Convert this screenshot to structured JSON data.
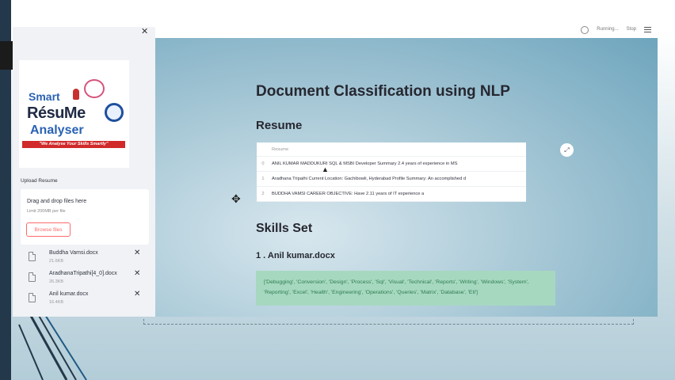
{
  "topbar": {
    "status_text": "Running...",
    "stop_label": "Stop"
  },
  "sidebar": {
    "logo": {
      "line1": "Smart",
      "line2": "RésuMe",
      "line3": "Analyser",
      "tagline": "\"We Analyse Your Skills Smartly\""
    },
    "upload_label": "Upload Resume",
    "dropzone": {
      "title": "Drag and drop files here",
      "limit": "Limit 200MB per file",
      "browse_label": "Browse files"
    },
    "files": [
      {
        "name": "Buddha Vamsi.docx",
        "size": "21.6KB"
      },
      {
        "name": "AradhanaTripathi[4_0].docx",
        "size": "26.3KB"
      },
      {
        "name": "Anil kumar.docx",
        "size": "16.4KB"
      }
    ]
  },
  "main": {
    "title": "Document Classification using NLP",
    "resume_heading": "Resume",
    "table": {
      "header": "Resume",
      "rows": [
        {
          "index": "0",
          "text": "ANIL KUMAR MADDUKURI        SQL & MSBI Developer              Summary    2.4 years of experience in MS"
        },
        {
          "index": "1",
          "text": "Aradhana Tripathi    Current Location: Gachibowli, Hyderabad    Profile Summary:    An accomplished d"
        },
        {
          "index": "2",
          "text": "BUDDHA VAMSI                                               CAREER OBJECTIVE:    Have 2.11 years of IT experience a"
        }
      ]
    },
    "skills_heading": "Skills Set",
    "file_heading": "1 . Anil kumar.docx",
    "skills_text": "['Debugging', 'Conversion', 'Design', 'Process', 'Sql', 'Visual', 'Technical', 'Reports', 'Writing', 'Windows', 'System', 'Reporting', 'Excel', 'Health', 'Engineering', 'Operations', 'Queries', 'Matrix', 'Database', 'Etl']"
  }
}
